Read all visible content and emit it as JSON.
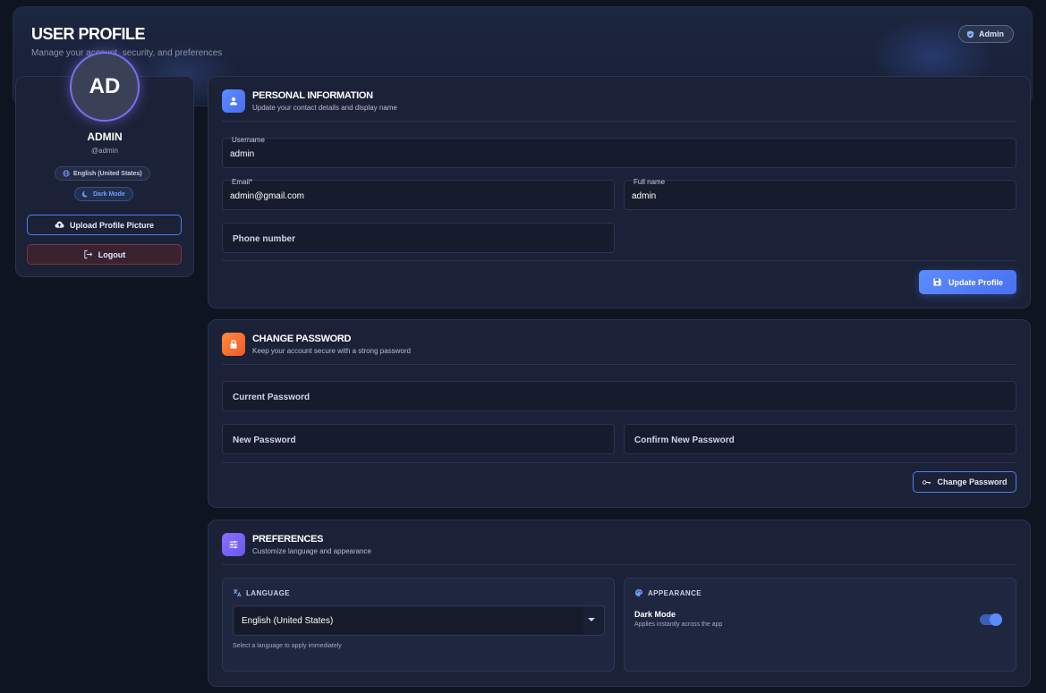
{
  "header": {
    "title": "USER PROFILE",
    "subtitle": "Manage your account, security, and preferences",
    "role_badge": "Admin"
  },
  "profile": {
    "initials": "AD",
    "name": "ADMIN",
    "handle": "@admin",
    "language_pill": "English (United States)",
    "mode_pill": "Dark Mode",
    "upload_button": "Upload Profile Picture",
    "logout_button": "Logout"
  },
  "personal": {
    "title": "PERSONAL INFORMATION",
    "subtitle": "Update your contact details and display name",
    "username_label": "Username",
    "username_value": "admin",
    "email_label": "Email*",
    "email_value": "admin@gmail.com",
    "fullname_label": "Full name",
    "fullname_value": "admin",
    "phone_placeholder": "Phone number",
    "update_button": "Update Profile"
  },
  "password": {
    "title": "CHANGE PASSWORD",
    "subtitle": "Keep your account secure with a strong password",
    "current_placeholder": "Current Password",
    "new_placeholder": "New Password",
    "confirm_placeholder": "Confirm New Password",
    "change_button": "Change Password"
  },
  "preferences": {
    "title": "PREFERENCES",
    "subtitle": "Customize language and appearance",
    "language_heading": "LANGUAGE",
    "language_selected": "English (United States)",
    "language_hint": "Select a language to apply immediately",
    "appearance_heading": "APPEARANCE",
    "dark_mode_label": "Dark Mode",
    "dark_mode_hint": "Applies instantly across the app",
    "dark_mode_on": true
  },
  "colors": {
    "background": "#0f1421",
    "card": "#1b2237",
    "accent": "#5b8cff",
    "avatar_ring": "#7a6ff0",
    "danger": "#7a3440"
  }
}
